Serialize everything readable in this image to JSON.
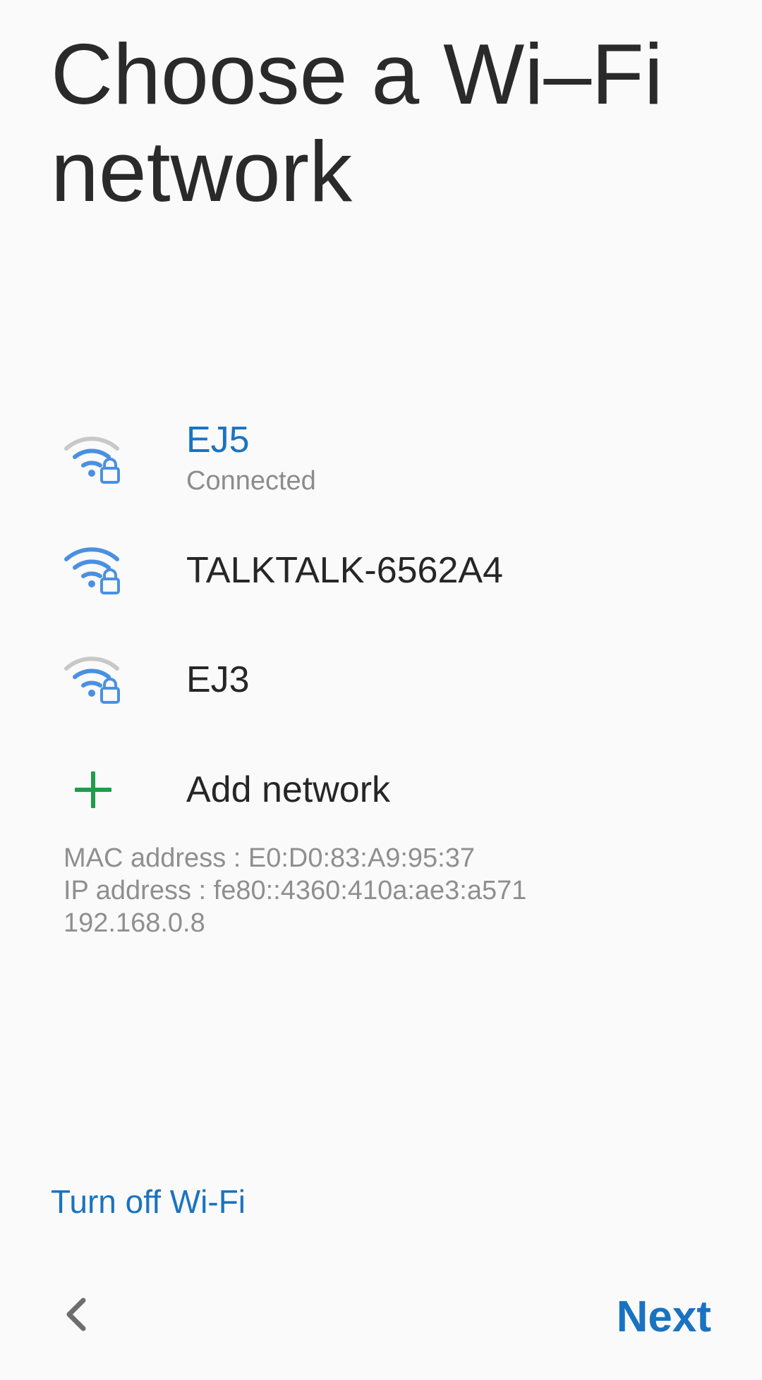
{
  "header": {
    "title": "Choose a Wi–Fi network"
  },
  "networks": [
    {
      "name": "EJ5",
      "status": "Connected",
      "icon": "wifi-lock-icon",
      "signal_level": 3,
      "connected": true
    },
    {
      "name": "TALKTALK-6562A4",
      "status": "",
      "icon": "wifi-lock-icon",
      "signal_level": 4,
      "connected": false
    },
    {
      "name": "EJ3",
      "status": "",
      "icon": "wifi-lock-icon",
      "signal_level": 3,
      "connected": false
    }
  ],
  "add_network": {
    "label": "Add network",
    "icon": "plus-icon"
  },
  "device_info": {
    "mac": "MAC address : E0:D0:83:A9:95:37",
    "ip": "IP address : fe80::4360:410a:ae3:a571",
    "ip4": "192.168.0.8"
  },
  "footer": {
    "turn_off_label": "Turn off Wi-Fi",
    "next_label": "Next",
    "back_icon": "chevron-left-icon"
  },
  "colors": {
    "accent": "#1a73c1",
    "wifi_active": "#4a90e2",
    "wifi_inactive": "#c8c8c8",
    "plus": "#1e9d4a",
    "background": "#fafafa"
  }
}
